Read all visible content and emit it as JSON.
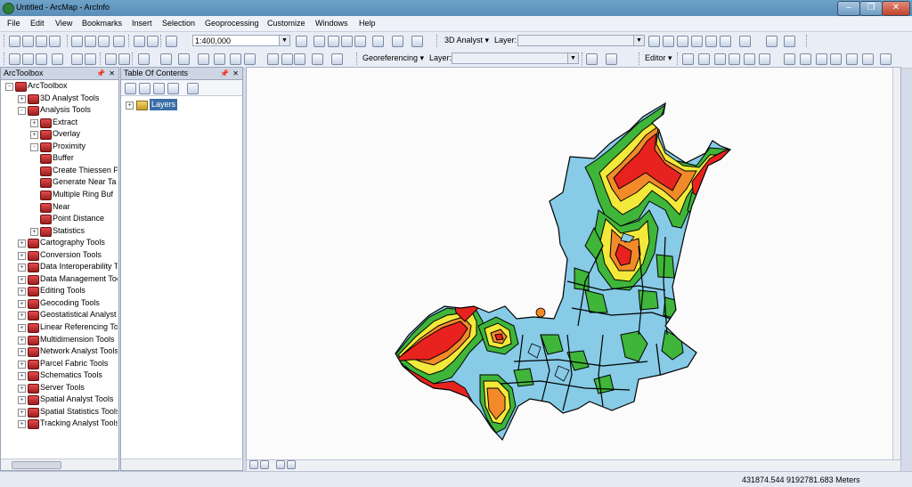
{
  "window": {
    "title": "Untitled - ArcMap - ArcInfo"
  },
  "menu": [
    "File",
    "Edit",
    "View",
    "Bookmarks",
    "Insert",
    "Selection",
    "Geoprocessing",
    "Customize",
    "Windows",
    "Help"
  ],
  "toolbar": {
    "scale": "1:400,000",
    "analyst3d_label": "3D Analyst ▾",
    "layer_label": "Layer:",
    "georef_label": "Georeferencing ▾",
    "layer2_label": "Layer:",
    "editor_label": "Editor ▾"
  },
  "arctoolbox": {
    "title": "ArcToolbox",
    "root": "ArcToolbox",
    "items": [
      {
        "label": "3D Analyst Tools",
        "level": 1,
        "exp": "+"
      },
      {
        "label": "Analysis Tools",
        "level": 1,
        "exp": "-"
      },
      {
        "label": "Extract",
        "level": 2,
        "exp": "+"
      },
      {
        "label": "Overlay",
        "level": 2,
        "exp": "+"
      },
      {
        "label": "Proximity",
        "level": 2,
        "exp": "-"
      },
      {
        "label": "Buffer",
        "level": 3,
        "exp": ""
      },
      {
        "label": "Create Thiessen P",
        "level": 3,
        "exp": ""
      },
      {
        "label": "Generate Near Ta",
        "level": 3,
        "exp": ""
      },
      {
        "label": "Multiple Ring Buf",
        "level": 3,
        "exp": ""
      },
      {
        "label": "Near",
        "level": 3,
        "exp": ""
      },
      {
        "label": "Point Distance",
        "level": 3,
        "exp": ""
      },
      {
        "label": "Statistics",
        "level": 2,
        "exp": "+"
      },
      {
        "label": "Cartography Tools",
        "level": 1,
        "exp": "+"
      },
      {
        "label": "Conversion Tools",
        "level": 1,
        "exp": "+"
      },
      {
        "label": "Data Interoperability Toc",
        "level": 1,
        "exp": "+"
      },
      {
        "label": "Data Management Tools",
        "level": 1,
        "exp": "+"
      },
      {
        "label": "Editing Tools",
        "level": 1,
        "exp": "+"
      },
      {
        "label": "Geocoding Tools",
        "level": 1,
        "exp": "+"
      },
      {
        "label": "Geostatistical Analyst To",
        "level": 1,
        "exp": "+"
      },
      {
        "label": "Linear Referencing Tools",
        "level": 1,
        "exp": "+"
      },
      {
        "label": "Multidimension Tools",
        "level": 1,
        "exp": "+"
      },
      {
        "label": "Network Analyst Tools",
        "level": 1,
        "exp": "+"
      },
      {
        "label": "Parcel Fabric Tools",
        "level": 1,
        "exp": "+"
      },
      {
        "label": "Schematics Tools",
        "level": 1,
        "exp": "+"
      },
      {
        "label": "Server Tools",
        "level": 1,
        "exp": "+"
      },
      {
        "label": "Spatial Analyst Tools",
        "level": 1,
        "exp": "+"
      },
      {
        "label": "Spatial Statistics Tools",
        "level": 1,
        "exp": "+"
      },
      {
        "label": "Tracking Analyst Tools",
        "level": 1,
        "exp": "+"
      }
    ]
  },
  "toc": {
    "title": "Table Of Contents",
    "layer": "Layers"
  },
  "status": {
    "coords": "431874.544  9192781.683 Meters"
  },
  "colors": {
    "ring_outer": "#87cbe6",
    "ring_green": "#3fb53a",
    "ring_yellow": "#f2e93a",
    "ring_orange": "#f28a2a",
    "core_red": "#e8231f"
  }
}
